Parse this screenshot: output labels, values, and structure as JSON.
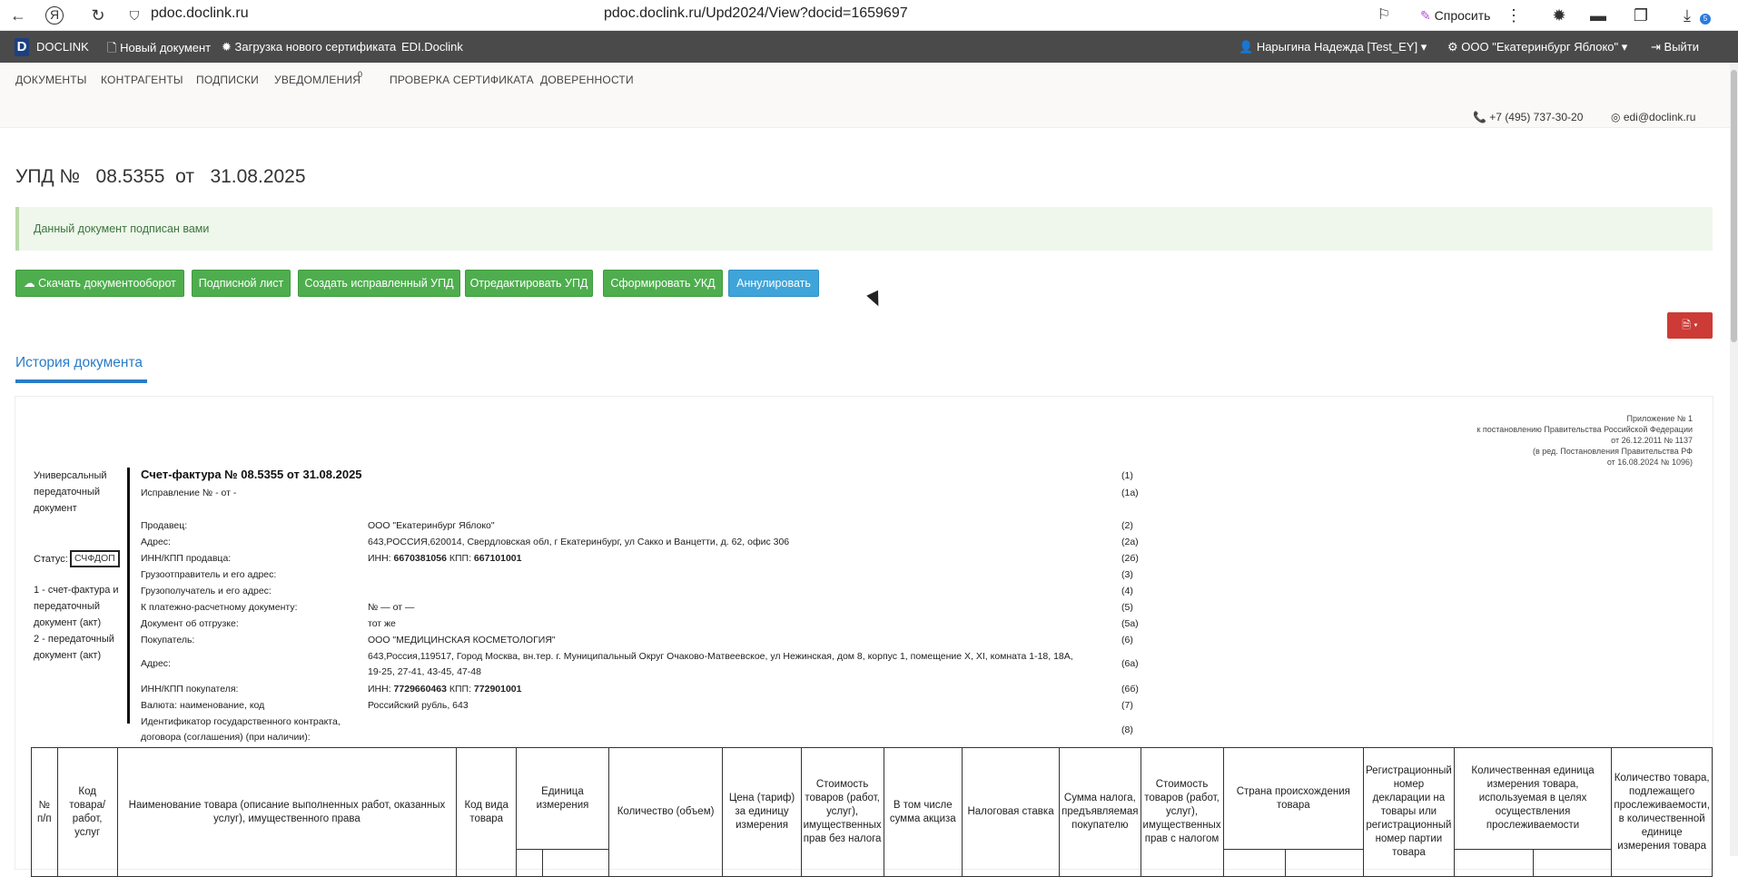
{
  "browser": {
    "host": "pdoc.doclink.ru",
    "url": "pdoc.doclink.ru/Upd2024/View?docid=1659697",
    "ask_label": "Спросить",
    "ext_badge": "5"
  },
  "topbar": {
    "logo_letter": "D",
    "brand": "DOCLINK",
    "new_doc": "Новый документ",
    "upload_cert": "Загрузка нового сертификата",
    "edi": "EDI.Doclink",
    "user": "Нарыгина Надежда [Test_EY]",
    "org": "ООО \"Екатеринбург Яблоко\"",
    "logout": "Выйти"
  },
  "nav": {
    "items": [
      "ДОКУМЕНТЫ",
      "КОНТРАГЕНТЫ",
      "ПОДПИСКИ",
      "УВЕДОМЛЕНИЯ",
      "ПРОВЕРКА СЕРТИФИКАТА",
      "ДОВЕРЕННОСТИ"
    ],
    "notif_count": "0",
    "phone": "+7 (495) 737-30-20",
    "email": "edi@doclink.ru"
  },
  "page": {
    "title": "УПД №   08.5355  от   31.08.2025",
    "alert": "Данный документ подписан вами",
    "buttons": [
      "Скачать документооборот",
      "Подписной лист",
      "Создать исправленный УПД",
      "Отредактировать УПД",
      "Сформировать УКД",
      "Аннулировать"
    ],
    "history_tab": "История документа"
  },
  "doc": {
    "appendix": [
      "Приложение № 1",
      "к постановлению Правительства Российской Федерации",
      "от 26.12.2011 № 1137",
      "(в ред. Постановления Правительства РФ",
      "от 16.08.2024 № 1096)"
    ],
    "left_label": "Универсальный передаточный документ",
    "status_label": "Статус:",
    "status_value": "СЧФДОП",
    "legend_1": "1 - счет-фактура и передаточный документ (акт)",
    "legend_2": "2 - передаточный документ (акт)",
    "heading": "Счет-фактура № 08.5355  от 31.08.2025",
    "heading_num": "(1)",
    "correction": "Исправление № - от -",
    "correction_num": "(1а)",
    "rows": [
      {
        "label": "Продавец:",
        "value": "ООО \"Екатеринбург Яблоко\"",
        "num": "(2)"
      },
      {
        "label": "Адрес:",
        "value": "643,РОССИЯ,620014, Свердловская обл, г Екатеринбург, ул Сакко и Ванцетти, д. 62, офис 306",
        "num": "(2а)"
      },
      {
        "label": "ИНН/КПП продавца:",
        "value_a": "ИНН: ",
        "value_b": "6670381056",
        "value_c": " КПП: ",
        "value_d": "667101001",
        "num": "(2б)"
      },
      {
        "label": "Грузоотправитель и его адрес:",
        "value": "",
        "num": "(3)"
      },
      {
        "label": "Грузополучатель и его адрес:",
        "value": "",
        "num": "(4)"
      },
      {
        "label": "К платежно-расчетному документу:",
        "value": "№   — от —",
        "num": "(5)"
      },
      {
        "label": "Документ об отгрузке:",
        "value": "тот же",
        "num": "(5а)"
      },
      {
        "label": "Покупатель:",
        "value": "ООО \"МЕДИЦИНСКАЯ КОСМЕТОЛОГИЯ\"",
        "num": "(6)"
      },
      {
        "label": "Адрес:",
        "value": "643,Россия,119517, Город Москва, вн.тер. г. Муниципальный Округ Очаково-Матвеевское, ул Нежинская, дом 8, корпус 1, помещение X, XI, комната 1-18, 18А,",
        "value2": "19-25, 27-41, 43-45, 47-48",
        "num": "(6а)"
      },
      {
        "label": "ИНН/КПП покупателя:",
        "value_a": "ИНН: ",
        "value_b": "7729660463",
        "value_c": " КПП: ",
        "value_d": "772901001",
        "num": "(6б)"
      },
      {
        "label": "Валюта: наименование, код",
        "value": "Российский рубль,  643",
        "num": "(7)"
      },
      {
        "label": "Идентификатор государственного контракта,",
        "label2": "договора (соглашения) (при наличии):",
        "value": "",
        "num": "(8)"
      }
    ],
    "table_headers": [
      "№ п/п",
      "Код товара/ работ, услуг",
      "Наименование товара (описание выполненных работ, оказанных услуг), имущественного права",
      "Код вида товара",
      "Единица измерения",
      "Количество (объем)",
      "Цена (тариф) за единицу измерения",
      "Стоимость товаров (работ, услуг), имущественных прав без налога",
      "В том числе сумма акциза",
      "Налоговая ставка",
      "Сумма налога, предъявляемая покупателю",
      "Стоимость товаров (работ, услуг), имущественных прав с налогом",
      "Страна происхождения товара",
      "Регистрационный номер декларации на товары или регистрационный номер партии товара",
      "Количественная единица измерения товара, используемая в целях осуществления прослеживаемости",
      "Количество товара, подлежащего прослеживаемости, в количественной единице измерения товара"
    ]
  }
}
